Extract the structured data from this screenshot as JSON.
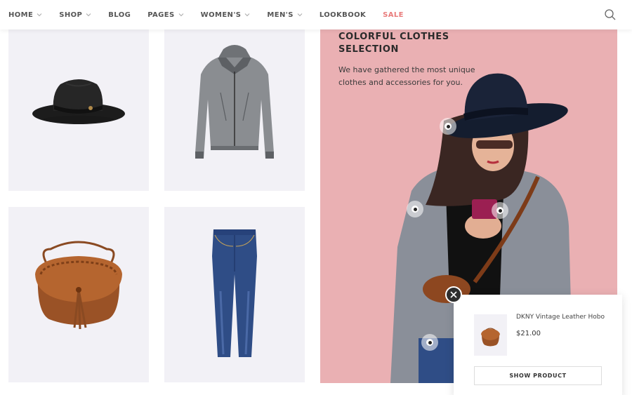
{
  "nav": {
    "items": [
      {
        "label": "HOME",
        "dropdown": true
      },
      {
        "label": "SHOP",
        "dropdown": true
      },
      {
        "label": "BLOG",
        "dropdown": false
      },
      {
        "label": "PAGES",
        "dropdown": true
      },
      {
        "label": "WOMEN'S",
        "dropdown": true
      },
      {
        "label": "MEN'S",
        "dropdown": true
      },
      {
        "label": "LOOKBOOK",
        "dropdown": false
      },
      {
        "label": "SALE",
        "dropdown": false
      }
    ],
    "search_icon": "search-icon",
    "sale_color": "#e97b7b"
  },
  "products": [
    {
      "image": "black-hat"
    },
    {
      "image": "grey-hoodie-jacket"
    },
    {
      "image": "brown-leather-bag"
    },
    {
      "image": "blue-jeans"
    }
  ],
  "lookbook": {
    "title": "COLORFUL CLOTHES SELECTION",
    "description": "We have gathered the most unique clothes and accessories for you.",
    "background_color": "#eab0b3"
  },
  "popup": {
    "product_name": "DKNY Vintage Leather Hobo",
    "price": "$21.00",
    "button_label": "SHOW PRODUCT",
    "close_icon": "close-icon"
  }
}
